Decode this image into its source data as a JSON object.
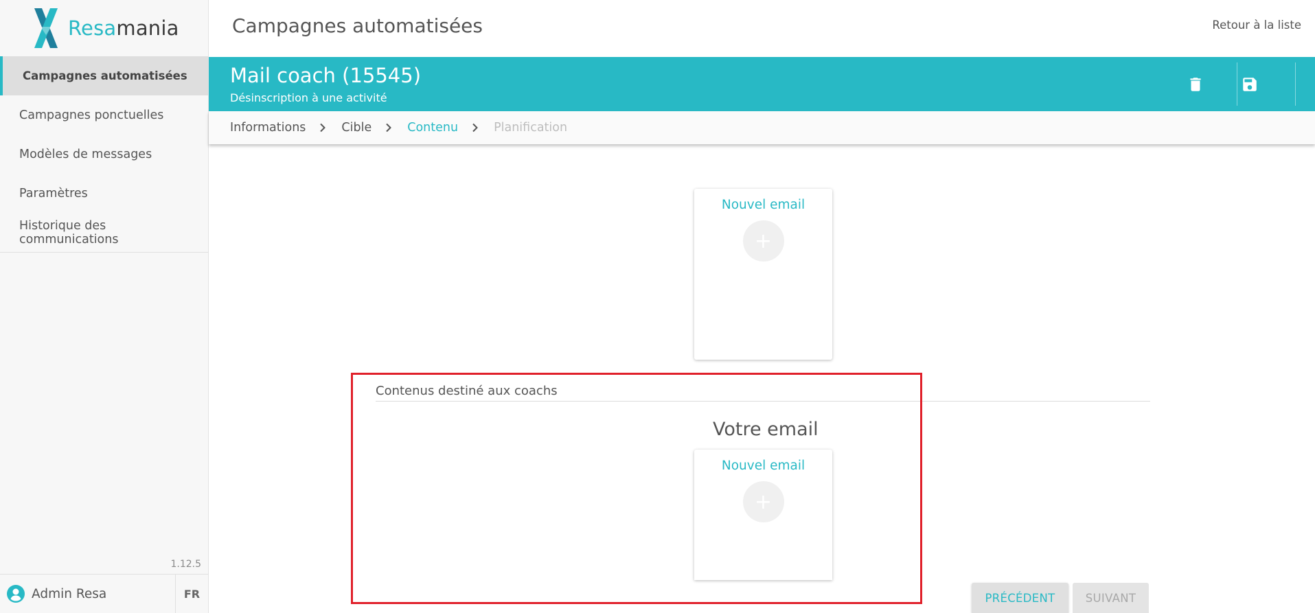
{
  "brand": {
    "name_part1": "Resa",
    "name_part2": "mania",
    "accent": "#28b9c5"
  },
  "sidebar": {
    "items": [
      {
        "label": "Campagnes automatisées",
        "active": true
      },
      {
        "label": "Campagnes ponctuelles",
        "active": false
      },
      {
        "label": "Modèles de messages",
        "active": false
      },
      {
        "label": "Paramètres",
        "active": false
      },
      {
        "label": "Historique des communications",
        "active": false
      }
    ],
    "version": "1.12.5",
    "user_name": "Admin Resa",
    "language": "FR"
  },
  "header": {
    "title": "Campagnes automatisées",
    "back_link": "Retour à la liste"
  },
  "campaign": {
    "title": "Mail coach (15545)",
    "subtitle": "Désinscription à une activité",
    "icons": [
      "trash-icon",
      "save-icon"
    ]
  },
  "steps": [
    {
      "label": "Informations",
      "state": "done"
    },
    {
      "label": "Cible",
      "state": "done"
    },
    {
      "label": "Contenu",
      "state": "current"
    },
    {
      "label": "Planification",
      "state": "disabled"
    }
  ],
  "content": {
    "card1_title": "Nouvel email",
    "section_label": "Contenus destiné aux coachs",
    "heading": "Votre email",
    "card2_title": "Nouvel email",
    "plus_glyph": "+"
  },
  "footer": {
    "prev_label": "PRÉCÉDENT",
    "next_label": "SUIVANT"
  }
}
